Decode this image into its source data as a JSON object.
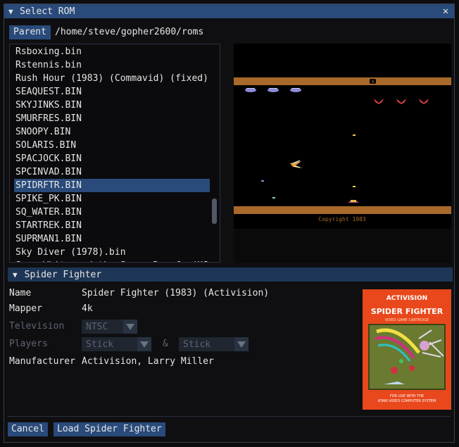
{
  "window": {
    "title": "Select ROM"
  },
  "parent_label": "Parent",
  "path": "/home/steve/gopher2600/roms",
  "files": [
    "Rsboxing.bin",
    "Rstennis.bin",
    "Rush Hour (1983) (Commavid) (fixed)",
    "SEAQUEST.BIN",
    "SKYJINKS.BIN",
    "SMURFRES.BIN",
    "SNOOPY.BIN",
    "SOLARIS.BIN",
    "SPACJOCK.BIN",
    "SPCINVAD.BIN",
    "SPIDRFTR.BIN",
    "SPIKE_PK.BIN",
    "SQ_WATER.BIN",
    "STARTREK.BIN",
    "SUPRMAN1.BIN",
    "Sky Diver (1978).bin",
    "Snow White and the Seven Dwarfs (US"
  ],
  "selected_index": 10,
  "preview": {
    "score": "0",
    "copyright": "Copyright 1983"
  },
  "section": {
    "title": "Spider Fighter"
  },
  "props": {
    "name_label": "Name",
    "name_value": "Spider Fighter (1983) (Activision)",
    "mapper_label": "Mapper",
    "mapper_value": "4k",
    "tv_label": "Television",
    "tv_value": "NTSC",
    "players_label": "Players",
    "player1": "Stick",
    "amp": "&",
    "player2": "Stick",
    "manufacturer_label": "Manufacturer",
    "manufacturer_value": "Activision, Larry Miller"
  },
  "cartridge": {
    "brand": "ACTIVISION",
    "title": "SPIDER FIGHTER",
    "subtitle": "VIDEO GAME CARTRIDGE",
    "footer1": "FOR USE WITH THE",
    "footer2": "ATARI VIDEO COMPUTER SYSTEM"
  },
  "buttons": {
    "cancel": "Cancel",
    "load": "Load Spider Fighter"
  },
  "colors": {
    "title_bar": "#294a7a",
    "selection": "#294a7a",
    "section_header": "#1e3656",
    "cart_orange": "#e8481c"
  }
}
